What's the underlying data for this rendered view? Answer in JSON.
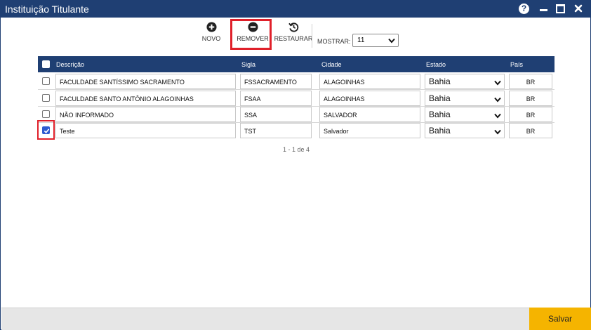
{
  "window": {
    "title": "Instituição Titulante",
    "help_glyph": "?"
  },
  "toolbar": {
    "novo_label": "NOVO",
    "remover_label": "REMOVER",
    "restaurar_label": "RESTAURAR",
    "mostrar_label": "MOSTRAR:",
    "mostrar_value": "11"
  },
  "table": {
    "headers": {
      "descricao": "Descrição",
      "sigla": "Sigla",
      "cidade": "Cidade",
      "estado": "Estado",
      "pais": "País"
    },
    "rows": [
      {
        "checked": false,
        "descricao": "FACULDADE SANTÍSSIMO SACRAMENTO",
        "sigla": "FSSACRAMENTO",
        "cidade": "ALAGOINHAS",
        "estado": "Bahia",
        "pais": "BR"
      },
      {
        "checked": false,
        "descricao": "FACULDADE SANTO ANTÔNIO ALAGOINHAS",
        "sigla": "FSAA",
        "cidade": "ALAGOINHAS",
        "estado": "Bahia",
        "pais": "BR"
      },
      {
        "checked": false,
        "descricao": "NÃO INFORMADO",
        "sigla": "SSA",
        "cidade": "SALVADOR",
        "estado": "Bahia",
        "pais": "BR"
      },
      {
        "checked": true,
        "descricao": "Teste",
        "sigla": "TST",
        "cidade": "Salvador",
        "estado": "Bahia",
        "pais": "BR"
      }
    ]
  },
  "pagination": {
    "text": "1 - 1 de 4"
  },
  "footer": {
    "save_label": "Salvar"
  },
  "colors": {
    "header_bg": "#1f3f73",
    "highlight": "#e0202a",
    "save_button": "#f5b400",
    "checkbox_checked": "#2f5bd0"
  }
}
